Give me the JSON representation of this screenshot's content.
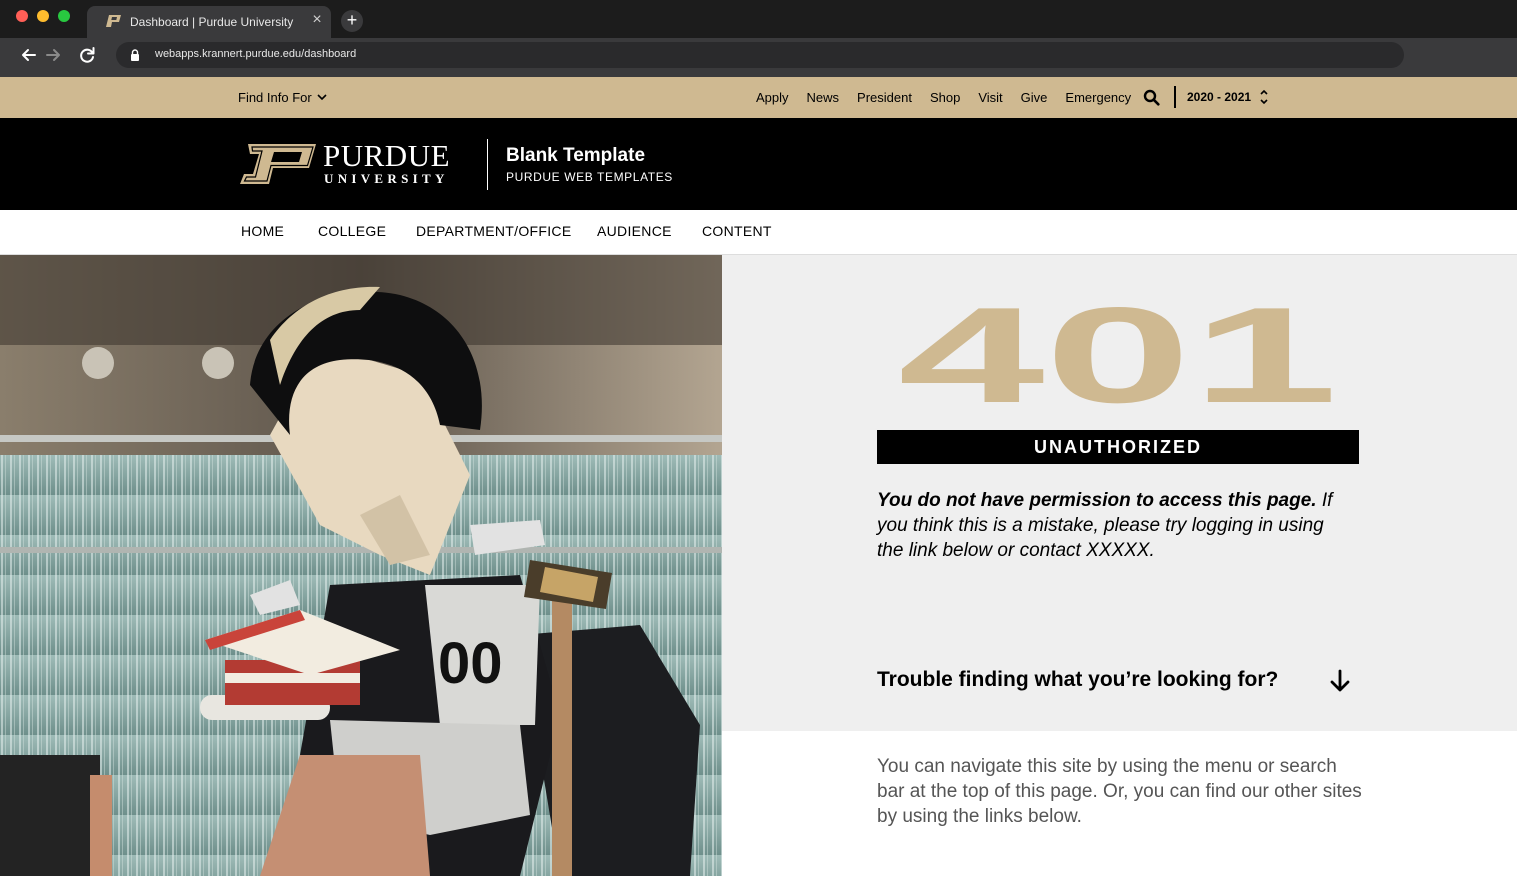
{
  "browser": {
    "tab_title": "Dashboard | Purdue University",
    "url": "webapps.krannert.purdue.edu/dashboard",
    "icons": [
      "back-icon",
      "forward-icon",
      "reload-icon",
      "lock-icon",
      "close-icon",
      "plus-icon"
    ]
  },
  "utility_bar": {
    "find_info": "Find Info For",
    "links": [
      "Apply",
      "News",
      "President",
      "Shop",
      "Visit",
      "Give",
      "Emergency"
    ],
    "year": "2020 - 2021"
  },
  "header": {
    "wordmark_line1": "PURDUE",
    "wordmark_line2": "UNIVERSITY",
    "site_title": "Blank Template",
    "site_subtitle": "PURDUE WEB TEMPLATES"
  },
  "main_nav": [
    "HOME",
    "COLLEGE",
    "DEPARTMENT/OFFICE",
    "AUDIENCE",
    "CONTENT"
  ],
  "error": {
    "code": "401",
    "label": "UNAUTHORIZED",
    "message_bold": "You do not have permission to access this page.",
    "message_rest": " If you think this is a mistake, please try logging in using the link below or contact XXXXX."
  },
  "help": {
    "heading": "Trouble finding what you’re looking for?",
    "text": "You can navigate this site by using the menu or search bar at the top of this page. Or, you can find our other sites by using the links below."
  },
  "colors": {
    "gold": "#cfb991",
    "black": "#000000",
    "gray_panel": "#efefef"
  }
}
